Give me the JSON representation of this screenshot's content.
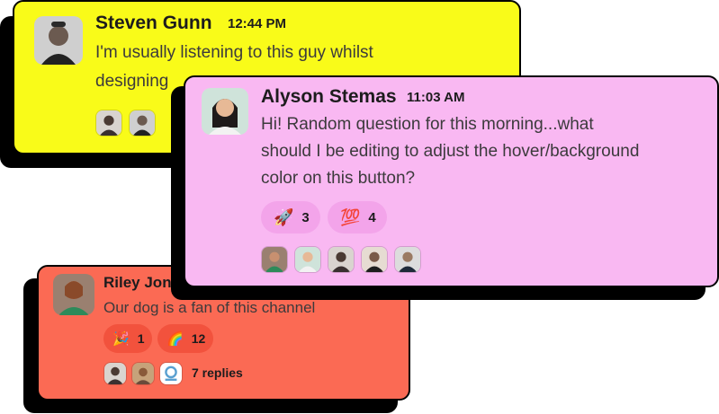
{
  "colors": {
    "card_yellow": "#f9fb19",
    "card_pink": "#f9b8f2",
    "card_red": "#fb6a54",
    "reaction_pink": "#f3a4ea",
    "reaction_red": "#f2523d",
    "shadow": "#000000"
  },
  "messages": [
    {
      "author": "Steven Gunn",
      "time": "12:44 PM",
      "text_line1": "I'm usually listening to this guy whilst",
      "text_line2": "designing"
    },
    {
      "author": "Alyson Stemas",
      "time": "11:03 AM",
      "text_line1": "Hi! Random question for this morning...what",
      "text_line2": "should I be editing to adjust the hover/background",
      "text_line3": "color on this button?",
      "reactions": [
        {
          "emoji": "🚀",
          "count": "3"
        },
        {
          "emoji": "💯",
          "count": "4"
        }
      ]
    },
    {
      "author": "Riley Jones",
      "text": "Our dog is a fan of this channel",
      "reactions": [
        {
          "emoji": "🎉",
          "count": "1"
        },
        {
          "emoji": "🌈",
          "count": "12"
        }
      ],
      "replies": "7 replies"
    }
  ]
}
